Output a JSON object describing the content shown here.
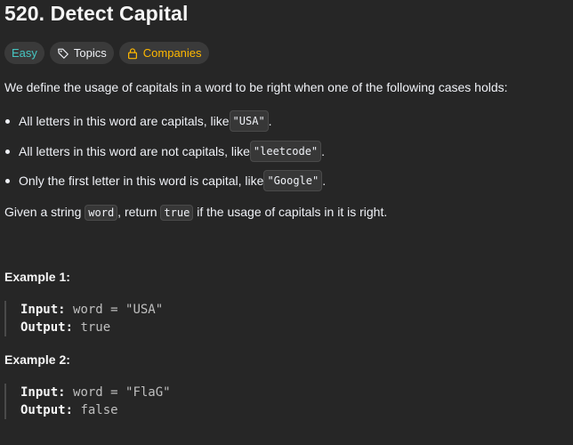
{
  "problem": {
    "title": "520. Detect Capital"
  },
  "tags": {
    "difficulty": "Easy",
    "topics": "Topics",
    "companies": "Companies",
    "colors": {
      "easy": "#46c6c2",
      "companies": "#ffb800"
    },
    "icons": {
      "topics": "tag-icon",
      "companies": "lock-icon"
    }
  },
  "description": {
    "intro": "We define the usage of capitals in a word to be right when one of the following cases holds:",
    "cases": [
      {
        "before": "All letters in this word are capitals, like ",
        "code": "\"USA\"",
        "after": "."
      },
      {
        "before": "All letters in this word are not capitals, like ",
        "code": "\"leetcode\"",
        "after": "."
      },
      {
        "before": "Only the first letter in this word is capital, like ",
        "code": "\"Google\"",
        "after": "."
      }
    ],
    "task": {
      "part1": "Given a string ",
      "code1": "word",
      "part2": ", return ",
      "code2": "true",
      "part3": " if the usage of capitals in it is right."
    }
  },
  "examples": [
    {
      "title": "Example 1:",
      "input_label": "Input:",
      "input_value": "word = \"USA\"",
      "output_label": "Output:",
      "output_value": "true"
    },
    {
      "title": "Example 2:",
      "input_label": "Input:",
      "input_value": "word = \"FlaG\"",
      "output_label": "Output:",
      "output_value": "false"
    }
  ]
}
